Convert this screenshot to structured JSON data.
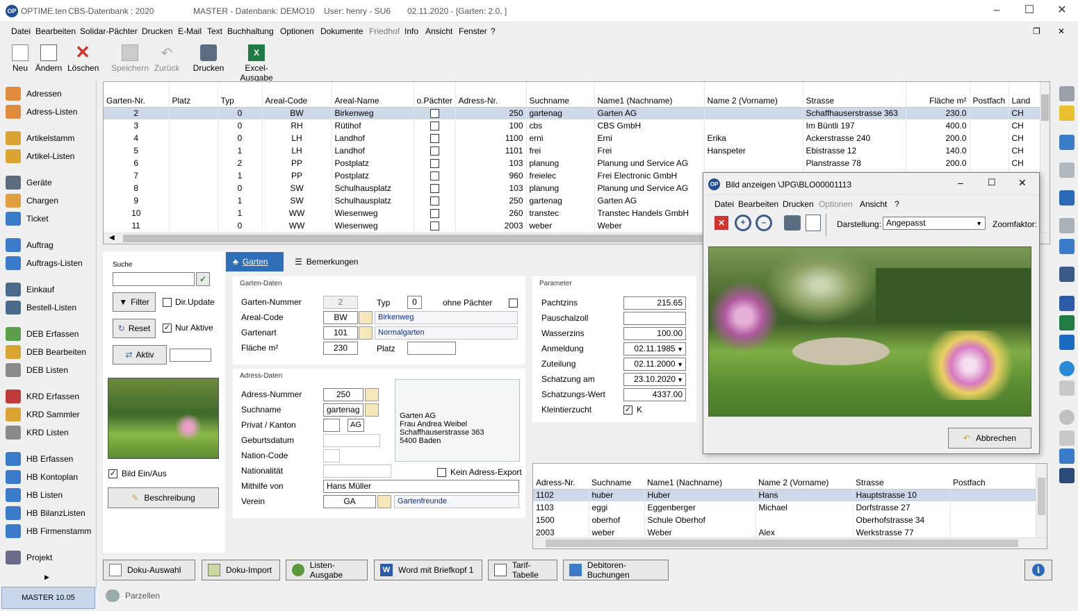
{
  "window": {
    "title_app": "OPTIME.ten",
    "title_db": "CBS-Datenbank : 2020",
    "title_master": "MASTER - Datenbank: DEMO10",
    "title_user": "User: henry - SU6",
    "title_date": "02.11.2020 - [Garten: 2.0, ]"
  },
  "menu": [
    "Datei",
    "Bearbeiten",
    "Solidar-Pächter",
    "Drucken",
    "E-Mail",
    "Text",
    "Buchhaltung",
    "Optionen",
    "Dokumente",
    "Friedhof",
    "Info",
    "Ansicht",
    "Fenster",
    "?"
  ],
  "toolbar": {
    "neu": "Neu",
    "aendern": "Ändern",
    "loeschen": "Löschen",
    "speichern": "Speichern",
    "zurueck": "Zurück",
    "drucken": "Drucken",
    "excel": "Excel-Ausgabe"
  },
  "sidebar": [
    "Adressen",
    "Adress-Listen",
    "Artikelstamm",
    "Artikel-Listen",
    "Geräte",
    "Chargen",
    "Ticket",
    "Auftrag",
    "Auftrags-Listen",
    "Einkauf",
    "Bestell-Listen",
    "DEB Erfassen",
    "DEB Bearbeiten",
    "DEB Listen",
    "KRD Erfassen",
    "KRD Sammler",
    "KRD Listen",
    "HB Erfassen",
    "HB Kontoplan",
    "HB Listen",
    "HB BilanzListen",
    "HB Firmenstamm",
    "Projekt"
  ],
  "status": {
    "left": "MASTER   10.05",
    "parzellen": "Parzellen"
  },
  "grid": {
    "headers": [
      "Garten-Nr.",
      "Platz",
      "Typ",
      "Areal-Code",
      "Areal-Name",
      "o.Pächter",
      "Adress-Nr.",
      "Suchname",
      "Name1 (Nachname)",
      "Name 2 (Vorname)",
      "Strasse",
      "Fläche m²",
      "Postfach",
      "Land"
    ],
    "rows": [
      [
        "2",
        "",
        "0",
        "BW",
        "Birkenweg",
        "250",
        "gartenag",
        "Garten AG",
        "",
        "Schaffhauserstrasse 363",
        "230.0",
        "",
        "CH"
      ],
      [
        "3",
        "",
        "0",
        "RH",
        "Rütihof",
        "100",
        "cbs",
        "CBS GmbH",
        "",
        "Im Büntli 197",
        "400.0",
        "",
        "CH"
      ],
      [
        "4",
        "",
        "0",
        "LH",
        "Landhof",
        "1100",
        "erni",
        "Erni",
        "Erika",
        "Ackerstrasse 240",
        "200.0",
        "",
        "CH"
      ],
      [
        "5",
        "",
        "1",
        "LH",
        "Landhof",
        "1101",
        "frei",
        "Frei",
        "Hanspeter",
        "Ebistrasse 12",
        "140.0",
        "",
        "CH"
      ],
      [
        "6",
        "",
        "2",
        "PP",
        "Postplatz",
        "103",
        "planung",
        "Planung und Service AG",
        "",
        "Planstrasse 78",
        "200.0",
        "",
        "CH"
      ],
      [
        "7",
        "",
        "1",
        "PP",
        "Postplatz",
        "960",
        "freielec",
        "Frei Electronic GmbH",
        "",
        "",
        "",
        "",
        ""
      ],
      [
        "8",
        "",
        "0",
        "SW",
        "Schulhausplatz",
        "103",
        "planung",
        "Planung und Service AG",
        "",
        "",
        "",
        "",
        ""
      ],
      [
        "9",
        "",
        "1",
        "SW",
        "Schulhausplatz",
        "250",
        "gartenag",
        "Garten AG",
        "",
        "",
        "",
        "",
        ""
      ],
      [
        "10",
        "",
        "1",
        "WW",
        "Wiesenweg",
        "260",
        "transtec",
        "Transtec Handels GmbH",
        "",
        "",
        "",
        "",
        ""
      ],
      [
        "11",
        "",
        "0",
        "WW",
        "Wiesenweg",
        "2003",
        "weber",
        "Weber",
        "",
        "",
        "",
        "",
        ""
      ]
    ]
  },
  "search": {
    "label": "Suche",
    "filter": "Filter",
    "dirupdate": "Dir.Update",
    "reset": "Reset",
    "nuraktive": "Nur Aktive",
    "aktiv": "Aktiv",
    "bild": "Bild Ein/Aus",
    "beschreibung": "Beschreibung"
  },
  "tabs": {
    "garten": "Garten",
    "bemerkungen": "Bemerkungen"
  },
  "garten": {
    "section": "Garten-Daten",
    "nr_label": "Garten-Nummer",
    "nr": "2",
    "typ_label": "Typ",
    "typ": "0",
    "ohne_label": "ohne Pächter",
    "areal_label": "Areal-Code",
    "areal": "BW",
    "areal_name": "Birkenweg",
    "art_label": "Gartenart",
    "art": "101",
    "art_name": "Normalgarten",
    "flaeche_label": "Fläche m²",
    "flaeche": "230",
    "platz_label": "Platz"
  },
  "adresse": {
    "section": "Adress-Daten",
    "nr_label": "Adress-Nummer",
    "nr": "250",
    "such_label": "Suchname",
    "such": "gartenag",
    "privat_label": "Privat / Kanton",
    "kanton": "AG",
    "geb_label": "Geburtsdatum",
    "nation_label": "Nation-Code",
    "nationalitaet_label": "Nationalität",
    "mithilfe_label": "Mithilfe von",
    "mithilfe": "Hans Müller",
    "verein_label": "Verein",
    "verein": "GA",
    "verein_name": "Gartenfreunde",
    "kein_export": "Kein Adress-Export",
    "addr1": "Garten AG",
    "addr2": "Frau Andrea Weibel",
    "addr3": "Schaffhauserstrasse 363",
    "addr4": "5400 Baden"
  },
  "params": {
    "section": "Parameter",
    "pachtzins_label": "Pachtzins",
    "pachtzins": "215.65",
    "pauschal_label": "Pauschalzoll",
    "wasser_label": "Wasserzins",
    "wasser": "100.00",
    "anmeldung_label": "Anmeldung",
    "anmeldung": "02.11.1985",
    "zuteilung_label": "Zuteilung",
    "zuteilung": "02.11.2000",
    "schatzung_label": "Schatzung am",
    "schatzung": "23.10.2020",
    "wert_label": "Schatzungs-Wert",
    "wert": "4337.00",
    "klein_label": "Kleintierzucht",
    "klein": "K"
  },
  "popup": {
    "title": "Bild anzeigen  \\JPG\\BLO00001113",
    "menu": [
      "Datei",
      "Bearbeiten",
      "Drucken",
      "Optionen",
      "Ansicht",
      "?"
    ],
    "darstellung_label": "Darstellung:",
    "darstellung": "Angepasst",
    "zoom_label": "Zoomfaktor:",
    "abbrechen": "Abbrechen"
  },
  "subgrid": {
    "headers": [
      "Adress-Nr.",
      "Suchname",
      "Name1 (Nachname)",
      "Name 2 (Vorname)",
      "Strasse",
      "Postfach"
    ],
    "rows": [
      [
        "1102",
        "huber",
        "Huber",
        "Hans",
        "Hauptstrasse 10",
        ""
      ],
      [
        "1103",
        "eggi",
        "Eggenberger",
        "Michael",
        "Dorfstrasse 27",
        ""
      ],
      [
        "1500",
        "oberhof",
        "Schule Oberhof",
        "",
        "Oberhofstrasse 34",
        ""
      ],
      [
        "2003",
        "weber",
        "Weber",
        "Alex",
        "Werkstrasse 77",
        ""
      ]
    ]
  },
  "bottom": [
    "Doku-Auswahl",
    "Doku-Import",
    "Listen-Ausgabe",
    "Word mit Briefkopf 1",
    "Tarif-Tabelle",
    "Debitoren-Buchungen"
  ]
}
